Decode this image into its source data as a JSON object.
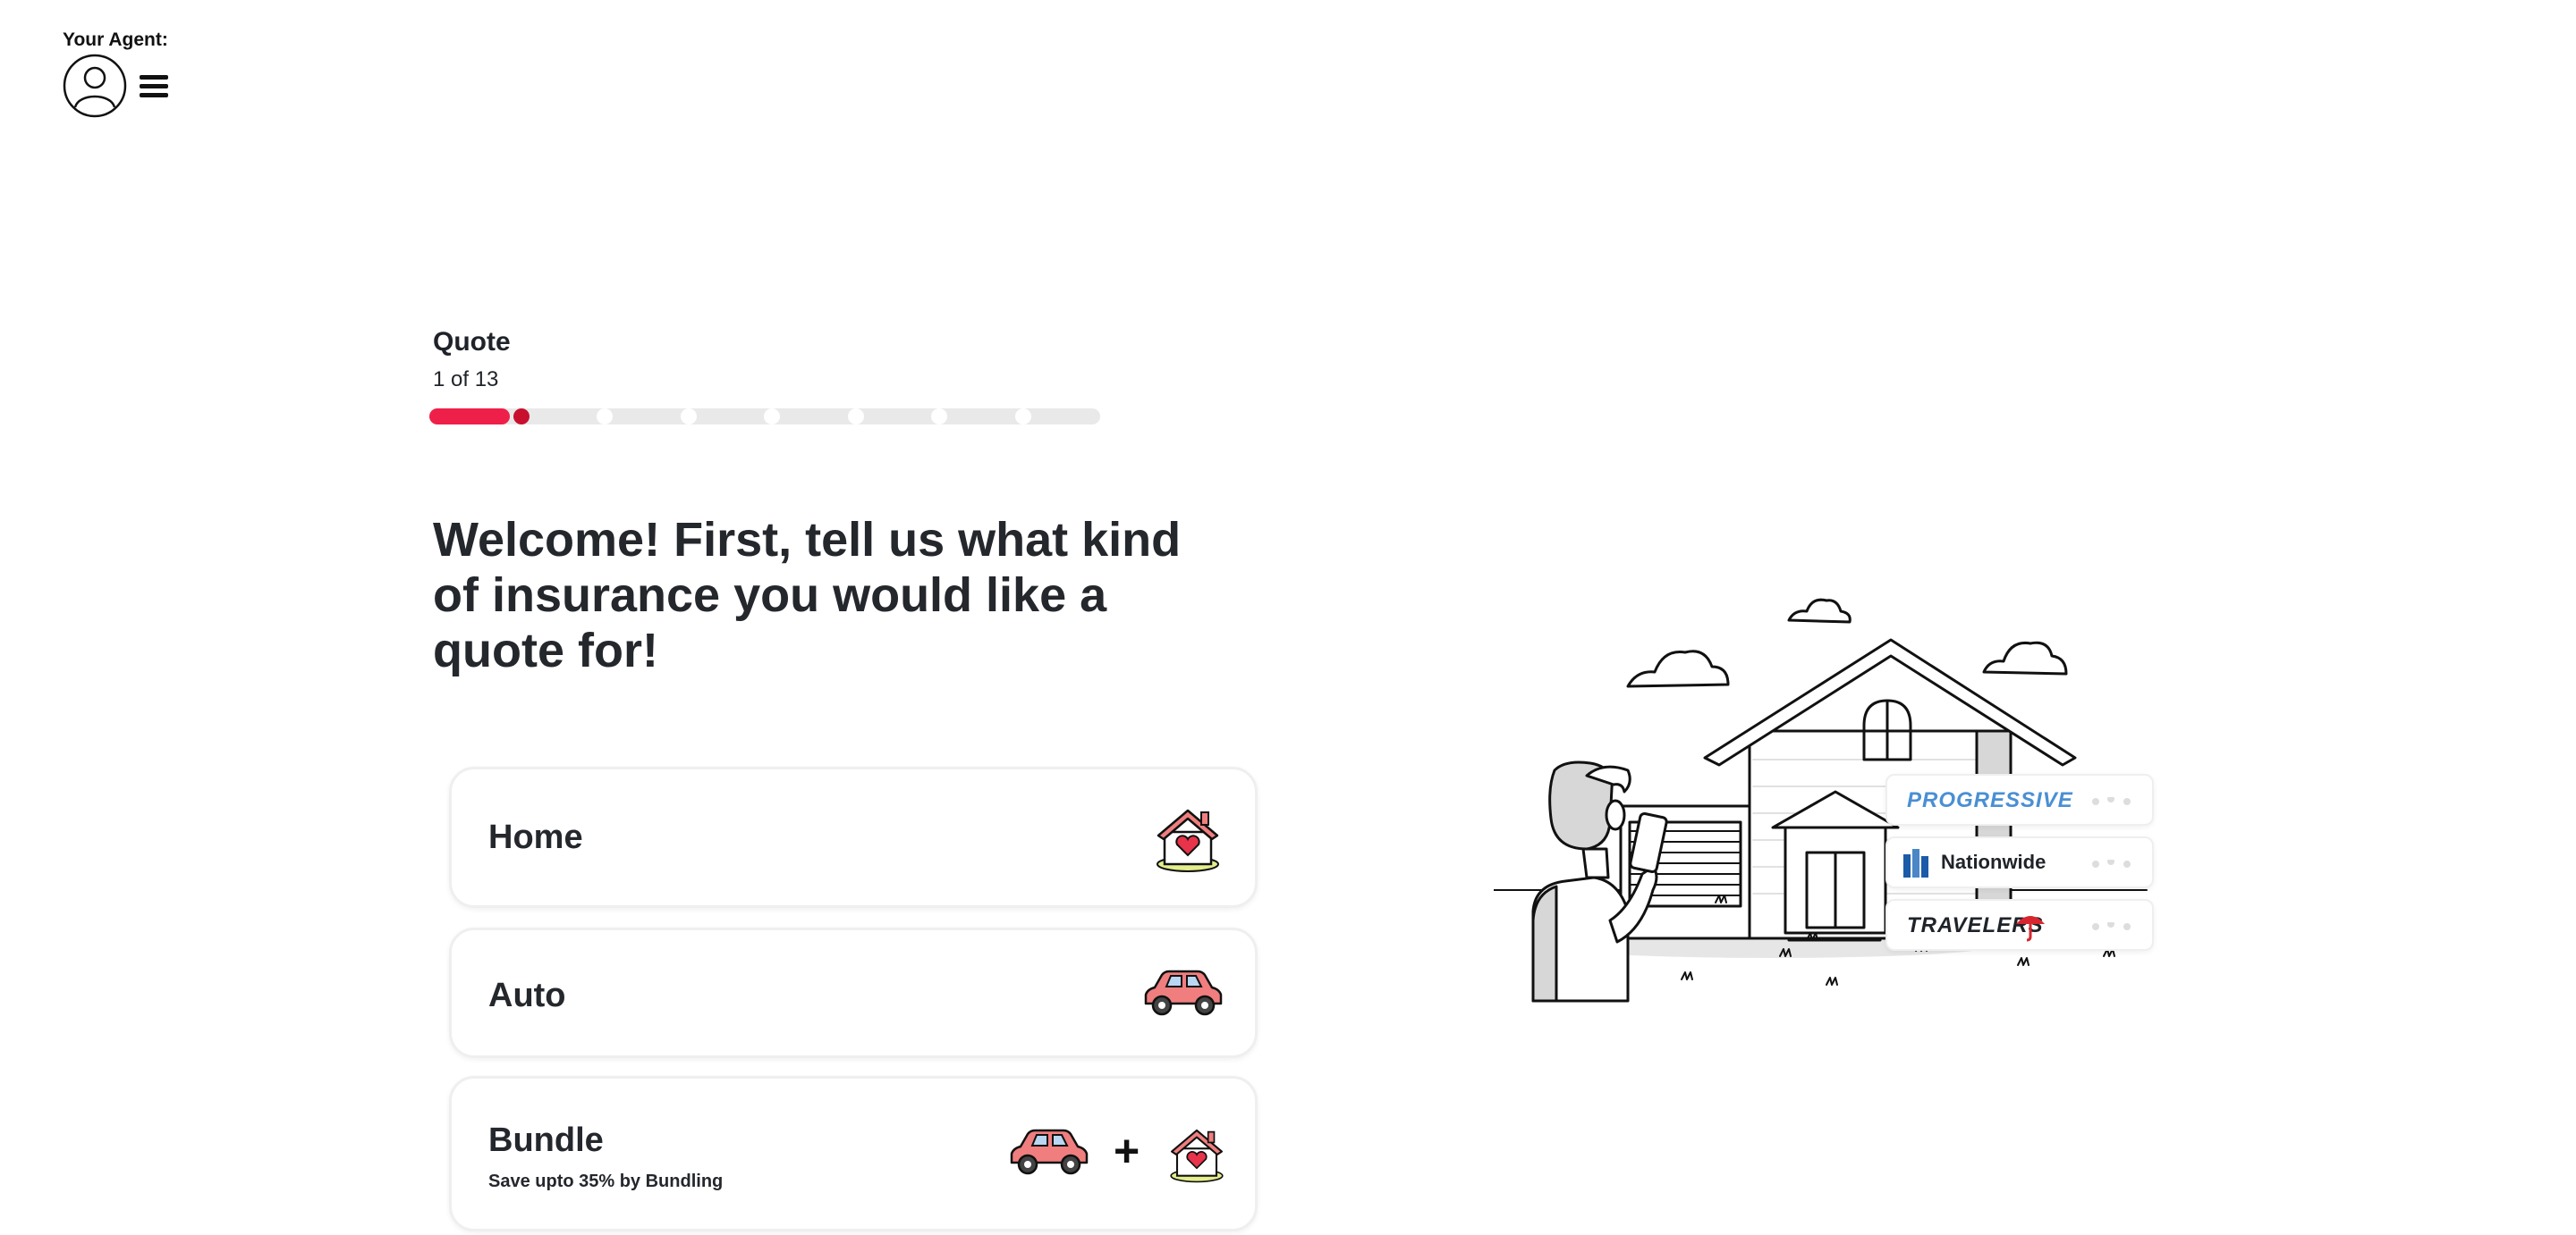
{
  "header": {
    "agent_label": "Your Agent:",
    "avatar_icon": "user-avatar-icon",
    "menu_icon": "hamburger-menu-icon"
  },
  "progress": {
    "title": "Quote",
    "step_text": "1 of 13",
    "current_step": 1,
    "total_steps": 13,
    "fill_fraction": 0.12,
    "accent_color": "#ee2049"
  },
  "main": {
    "headline": "Welcome! First, tell us what kind of insurance you would like a quote for!",
    "options": [
      {
        "label": "Home",
        "icon": "house-heart-icon"
      },
      {
        "label": "Auto",
        "icon": "car-icon"
      },
      {
        "label": "Bundle",
        "subtitle": "Save upto 35% by Bundling",
        "icon": "car-plus-house-icon",
        "plus": "+"
      }
    ]
  },
  "illustration": {
    "carriers": [
      {
        "name": "PROGRESSIVE",
        "color": "#4a8fd4"
      },
      {
        "name": "Nationwide",
        "color": "#1a1a1a"
      },
      {
        "name": "TRAVELERS",
        "color": "#1a1a1a"
      }
    ]
  }
}
